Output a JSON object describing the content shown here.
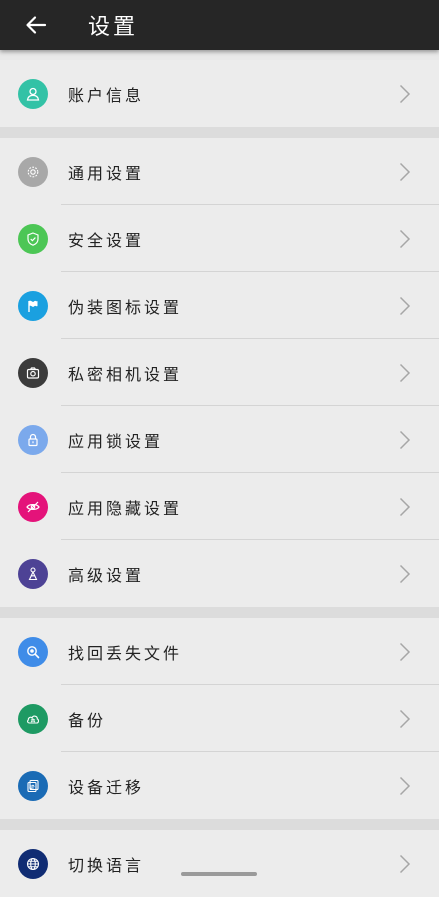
{
  "header": {
    "title": "设置"
  },
  "groups": [
    {
      "items": [
        {
          "label": "账户信息",
          "icon": "account-icon",
          "color": "#33c2a6"
        }
      ]
    },
    {
      "items": [
        {
          "label": "通用设置",
          "icon": "gear-icon",
          "color": "#a8a8a8"
        },
        {
          "label": "安全设置",
          "icon": "shield-icon",
          "color": "#4cc655"
        },
        {
          "label": "伪装图标设置",
          "icon": "flag-icon",
          "color": "#1aa0e0"
        },
        {
          "label": "私密相机设置",
          "icon": "camera-icon",
          "color": "#3b3b3b"
        },
        {
          "label": "应用锁设置",
          "icon": "lock-icon",
          "color": "#7ba9ec"
        },
        {
          "label": "应用隐藏设置",
          "icon": "eye-off-icon",
          "color": "#e4137a"
        },
        {
          "label": "高级设置",
          "icon": "advanced-icon",
          "color": "#4d4295"
        }
      ]
    },
    {
      "items": [
        {
          "label": "找回丢失文件",
          "icon": "search-file-icon",
          "color": "#3f8ce8"
        },
        {
          "label": "备份",
          "icon": "cloud-backup-icon",
          "color": "#1e9a63"
        },
        {
          "label": "设备迁移",
          "icon": "migrate-icon",
          "color": "#1a6bb5"
        }
      ]
    },
    {
      "items": [
        {
          "label": "切换语言",
          "icon": "globe-icon",
          "color": "#102c73"
        }
      ]
    }
  ]
}
